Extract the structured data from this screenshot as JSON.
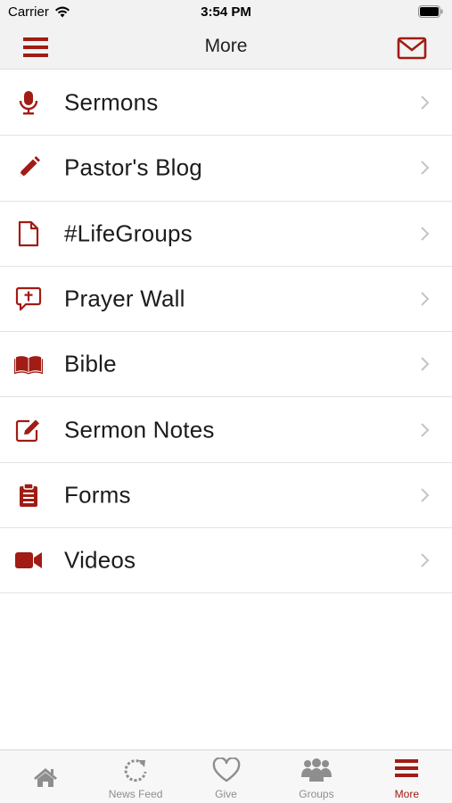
{
  "status_bar": {
    "carrier": "Carrier",
    "time": "3:54 PM"
  },
  "nav": {
    "title": "More"
  },
  "accent_color": "#a01c14",
  "menu_items": [
    {
      "label": "Sermons",
      "icon": "microphone-icon"
    },
    {
      "label": "Pastor's Blog",
      "icon": "pencil-icon"
    },
    {
      "label": "#LifeGroups",
      "icon": "document-icon"
    },
    {
      "label": "Prayer Wall",
      "icon": "prayer-bubble-icon"
    },
    {
      "label": "Bible",
      "icon": "open-book-icon"
    },
    {
      "label": "Sermon Notes",
      "icon": "edit-note-icon"
    },
    {
      "label": "Forms",
      "icon": "clipboard-icon"
    },
    {
      "label": "Videos",
      "icon": "video-camera-icon"
    }
  ],
  "tabs": [
    {
      "label": "",
      "icon": "home-icon"
    },
    {
      "label": "News Feed",
      "icon": "refresh-icon"
    },
    {
      "label": "Give",
      "icon": "heart-icon"
    },
    {
      "label": "Groups",
      "icon": "people-icon"
    },
    {
      "label": "More",
      "icon": "menu-icon",
      "active": true
    }
  ]
}
